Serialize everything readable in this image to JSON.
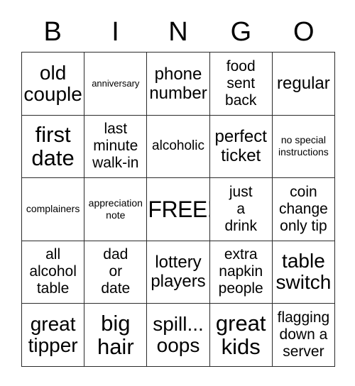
{
  "card": {
    "headers": [
      "B",
      "I",
      "N",
      "G",
      "O"
    ],
    "rows": [
      [
        {
          "text": "old\ncouple",
          "size": "xl"
        },
        {
          "text": "anniversary",
          "size": "xxs"
        },
        {
          "text": "phone\nnumber",
          "size": "lg"
        },
        {
          "text": "food\nsent\nback",
          "size": "md"
        },
        {
          "text": "regular",
          "size": "lg"
        }
      ],
      [
        {
          "text": "first\ndate",
          "size": "xxl"
        },
        {
          "text": "last\nminute\nwalk-in",
          "size": "md"
        },
        {
          "text": "alcoholic",
          "size": "sm"
        },
        {
          "text": "perfect\nticket",
          "size": "lg"
        },
        {
          "text": "no special\ninstructions",
          "size": "xs"
        }
      ],
      [
        {
          "text": "complainers",
          "size": "xs"
        },
        {
          "text": "appreciation\nnote",
          "size": "xs"
        },
        {
          "text": "FREE!",
          "size": "free"
        },
        {
          "text": "just\na\ndrink",
          "size": "md"
        },
        {
          "text": "coin\nchange\nonly tip",
          "size": "md"
        }
      ],
      [
        {
          "text": "all\nalcohol\ntable",
          "size": "md"
        },
        {
          "text": "dad\nor\ndate",
          "size": "md"
        },
        {
          "text": "lottery\nplayers",
          "size": "lg"
        },
        {
          "text": "extra\nnapkin\npeople",
          "size": "md"
        },
        {
          "text": "table\nswitch",
          "size": "xl"
        }
      ],
      [
        {
          "text": "great\ntipper",
          "size": "xl"
        },
        {
          "text": "big\nhair",
          "size": "xxl"
        },
        {
          "text": "spill...\noops",
          "size": "xl"
        },
        {
          "text": "great\nkids",
          "size": "xxl"
        },
        {
          "text": "flagging\ndown a\nserver",
          "size": "md"
        }
      ]
    ]
  }
}
